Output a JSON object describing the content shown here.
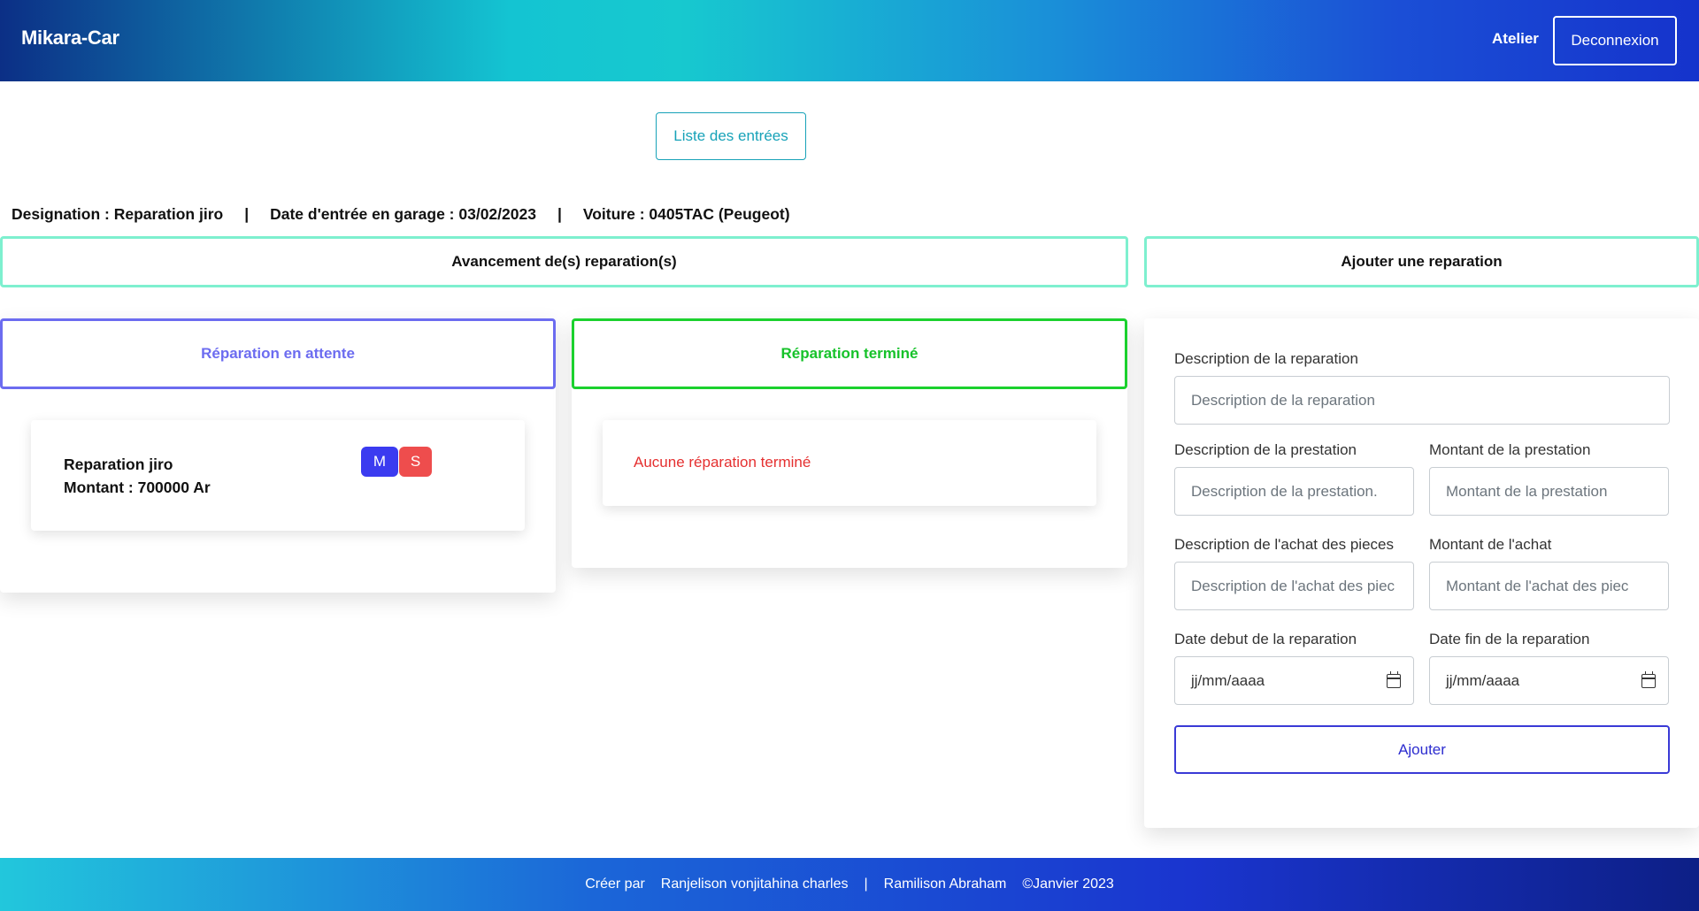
{
  "navbar": {
    "brand": "Mikara-Car",
    "link": "Atelier",
    "logout": "Deconnexion"
  },
  "list_button": "Liste des entrées",
  "info": {
    "designation": "Designation : Reparation jiro",
    "date": "Date d'entrée en garage : 03/02/2023",
    "voiture": "Voiture : 0405TAC (Peugeot)",
    "separator": "|"
  },
  "sections": {
    "progress": "Avancement de(s) reparation(s)",
    "add": "Ajouter une reparation"
  },
  "pending": {
    "title": "Réparation en attente",
    "item": {
      "name": "Reparation jiro",
      "amount": "Montant : 700000 Ar",
      "badge_m": "M",
      "badge_s": "S"
    }
  },
  "done": {
    "title": "Réparation terminé",
    "empty": "Aucune réparation terminé"
  },
  "form": {
    "desc_label": "Description de la reparation",
    "desc_placeholder": "Description de la reparation",
    "prest_desc_label": "Description de la prestation",
    "prest_desc_placeholder": "Description de la prestation.",
    "prest_amount_label": "Montant de la prestation",
    "prest_amount_placeholder": "Montant de la prestation",
    "pieces_desc_label": "Description de l'achat des pieces",
    "pieces_desc_placeholder": "Description de l'achat des piec",
    "pieces_amount_label": "Montant de l'achat",
    "pieces_amount_placeholder": "Montant de l'achat des piec",
    "date_start_label": "Date debut de la reparation",
    "date_start_value": "jj/mm/aaaa",
    "date_end_label": "Date fin de la reparation",
    "date_end_value": "jj/mm/aaaa",
    "submit": "Ajouter"
  },
  "footer": {
    "created_by": "Créer par",
    "author1": "Ranjelison vonjitahina charles",
    "separator": "|",
    "author2": "Ramilison Abraham",
    "copyright": "©Janvier 2023"
  },
  "colors": {
    "teal": "#17a2b8",
    "section_border": "#7ef0cf",
    "pending": "#6c6cf0",
    "done": "#1bd12e",
    "danger": "#e53030",
    "primary": "#3a3ad6"
  }
}
